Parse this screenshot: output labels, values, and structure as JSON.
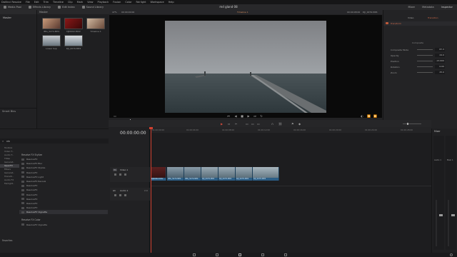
{
  "menubar": {
    "items": [
      "DaVinci Resolve",
      "File",
      "Edit",
      "Trim",
      "Timeline",
      "Clip",
      "Mark",
      "View",
      "Playback",
      "Fusion",
      "Color",
      "Fairlight",
      "Workspace",
      "Help"
    ]
  },
  "toolbar": {
    "media_pool": "Media Pool",
    "effects_library": "Effects Library",
    "edit_index": "Edit Index",
    "sound_library": "Sound Library",
    "project_title": "md gland 08",
    "mixer": "Mixer",
    "metadata": "Metadata",
    "inspector": "Inspector"
  },
  "media_pool": {
    "header": "Master",
    "bins": {
      "master": "Master",
      "smart_bins": "Smart Bins"
    },
    "clips": [
      {
        "label": "IMG_5274.MP4",
        "color": "#a08070"
      },
      {
        "label": "DJI0002.MOV",
        "color": "#7a1a1a"
      },
      {
        "label": "Timeline 1",
        "color": "#9a8070"
      },
      {
        "label": "Lower Sup",
        "color": "#8a9aa8"
      },
      {
        "label": "DJI_0079.MP4",
        "color": "#a8b0b8"
      }
    ]
  },
  "viewer": {
    "zoom": "47%",
    "source_timecode": "00:00:00:00",
    "timeline_name": "Timeline 1",
    "timecode_right": "00:00:08:00",
    "clip_name_right": "DJI_0079.MP4"
  },
  "inspector": {
    "tabs": [
      "Video",
      "Transition"
    ],
    "section": "Transform",
    "subsection": "Composite",
    "rows": [
      {
        "label": "Composite Mode",
        "value": "87.3"
      },
      {
        "label": "Opacity",
        "value": "24.0"
      },
      {
        "label": "Position",
        "value": "-13.000"
      },
      {
        "label": "Rotation",
        "value": "0.00"
      },
      {
        "label": "Zoom",
        "value": "25.0"
      }
    ]
  },
  "effects": {
    "search_value": "vin",
    "tree": [
      {
        "label": "Toolbox",
        "selected": false
      },
      {
        "label": "Video T..",
        "selected": false
      },
      {
        "label": "Audio T..",
        "selected": false
      },
      {
        "label": "Titles",
        "selected": false
      },
      {
        "label": "Generat..",
        "selected": false
      },
      {
        "label": "OpenFX",
        "selected": true
      },
      {
        "label": "Filters",
        "selected": false
      },
      {
        "label": "Generat..",
        "selected": false
      },
      {
        "label": "Transiti..",
        "selected": false
      },
      {
        "label": "Audio FX",
        "selected": false
      },
      {
        "label": "Fairlight..",
        "selected": false
      }
    ],
    "group_title": "Resolve FX Stylize",
    "items": [
      {
        "label": "ResolveFX",
        "selected": false
      },
      {
        "label": "ResolveFX Blur",
        "selected": false
      },
      {
        "label": "ResolveFX Stylize",
        "selected": false
      },
      {
        "label": "ResolveFX",
        "selected": false
      },
      {
        "label": "ResolveFX Light",
        "selected": false
      },
      {
        "label": "ResolveFX Revival",
        "selected": false
      },
      {
        "label": "ResolveFX",
        "selected": false
      },
      {
        "label": "ResolveFX",
        "selected": false
      },
      {
        "label": "ResolveFX",
        "selected": false
      },
      {
        "label": "ResolveFX",
        "selected": false
      },
      {
        "label": "ResolveFX",
        "selected": false
      },
      {
        "label": "ResolveFX",
        "selected": false
      },
      {
        "label": "ResolveFX Vignette",
        "selected": true
      }
    ],
    "group2_title": "Resolve FX Color",
    "group2_first": "ResolveFX Vignette",
    "favorites": "Favorites"
  },
  "timeline": {
    "timecode": "00:00:00:00",
    "ruler": [
      "01:00:00:00",
      "01:00:04:00",
      "01:00:08:00",
      "01:00:12:00",
      "01:00:16:00",
      "01:00:20:00",
      "01:00:24:00",
      "01:00:28:00"
    ],
    "video_track": {
      "id": "V1",
      "name": "Video 1"
    },
    "audio_track": {
      "id": "A1",
      "name": "Audio 1",
      "level": "2.0"
    },
    "clips": [
      "DJI0002.MOV",
      "IMG_5274.MP4",
      "IMG_5274.MP4",
      "DJI_0079.MP4",
      "DJI_0079.MP4",
      "DJI_0079.MP4",
      "DJI_0079.MP4"
    ]
  },
  "mixer": {
    "title": "Mixer",
    "ch1": "Audio 1",
    "ch2": "Main 1"
  }
}
